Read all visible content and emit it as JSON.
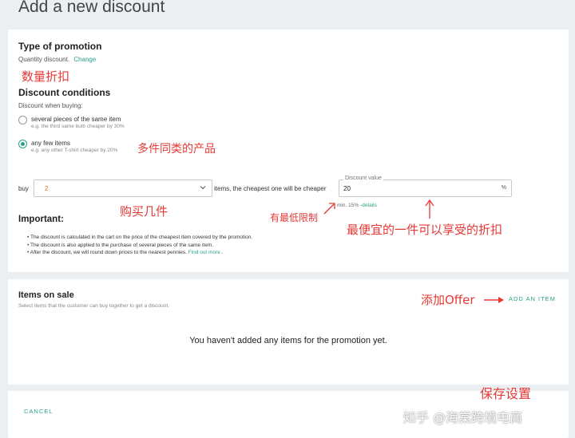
{
  "page_title": "Add a new discount",
  "promotion": {
    "type_heading": "Type of promotion",
    "type_value": "Quantity discount.",
    "change_link": "Change",
    "conditions_heading": "Discount conditions",
    "when_buying_label": "Discount when buying:",
    "options": [
      {
        "label": "several pieces of the same item",
        "hint": "e.g. the third same bulb cheaper by 30%",
        "selected": false
      },
      {
        "label": "any few items",
        "hint": "e.g. any other T-shirt cheaper by 20%",
        "selected": true
      }
    ],
    "buy_label": "buy",
    "buy_value": "2",
    "items_text": "items, the cheapest one will be cheaper",
    "discount_value_legend": "Discount value",
    "discount_value": "20",
    "discount_unit": "%",
    "min_note": "min. 15%",
    "details_link": "-details",
    "important_heading": "Important:",
    "important_items": [
      "The discount is calculated in the cart on the price of the cheapest item covered by the promotion.",
      "The discount is also applied to the purchase of several pieces of the same item."
    ],
    "important_last": "After the discount, we will round down prices to the nearest pennies.",
    "find_out_more": "Find out more",
    "find_out_more_suffix": "."
  },
  "items_on_sale": {
    "heading": "Items on sale",
    "subtitle": "Select items that the customer can buy together to get a discount.",
    "add_item_button": "ADD AN ITEM",
    "empty_message": "You haven't added any items for the promotion yet."
  },
  "footer": {
    "cancel_button": "CANCEL"
  },
  "annotations": {
    "quantity_discount": "数量折扣",
    "multiple_items": "多件同类的产品",
    "buy_count": "购买几件",
    "min_limit": "有最低限制",
    "cheapest_discount": "最便宜的一件可以享受的折扣",
    "add_offer": "添加Offer",
    "save_settings": "保存设置"
  },
  "watermark": "知乎 @海棠跨境电商",
  "colors": {
    "accent": "#2aa189",
    "annotation": "#e53935",
    "buy_value": "#e07020"
  }
}
